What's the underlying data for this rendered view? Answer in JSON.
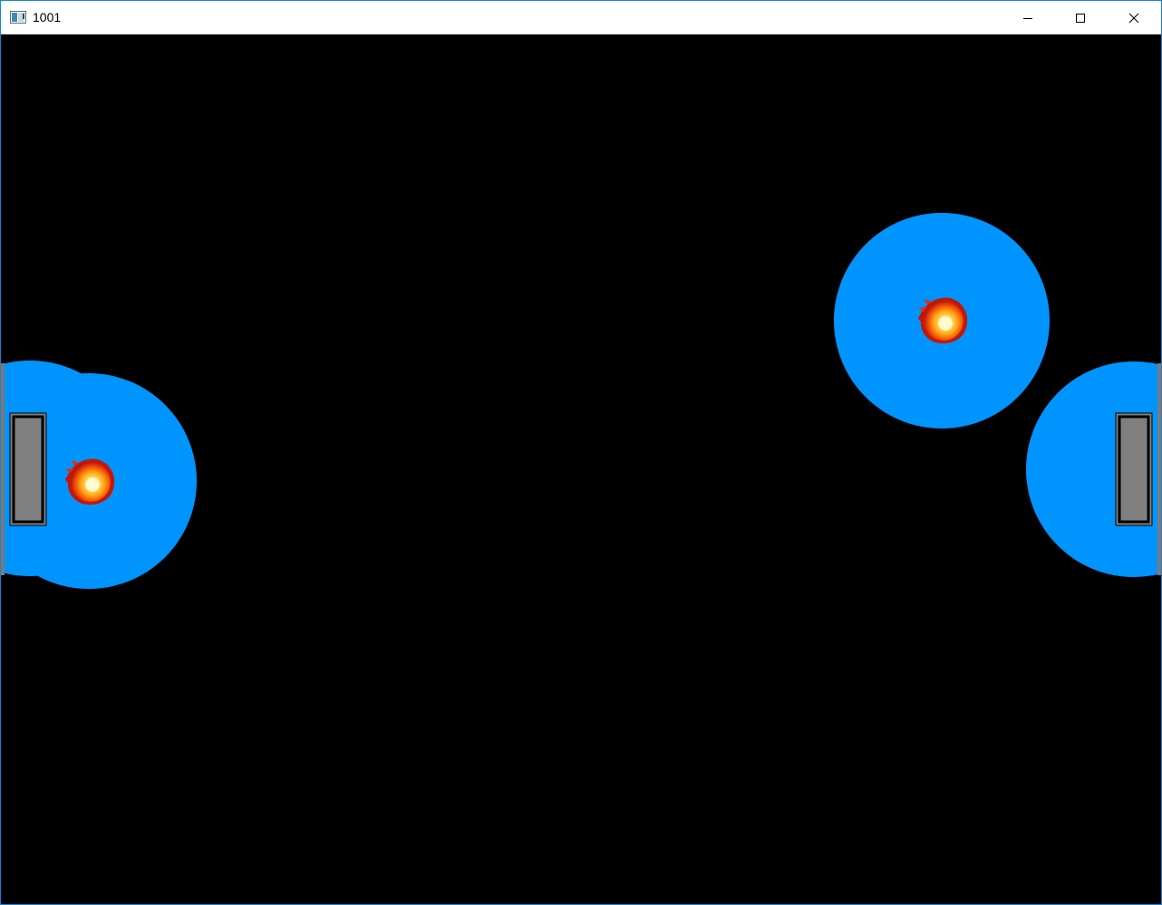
{
  "window": {
    "title": "1001",
    "controls": {
      "minimize_icon": "minimize-icon",
      "maximize_icon": "maximize-icon",
      "close_icon": "close-icon"
    }
  },
  "game": {
    "background_color": "#000000",
    "aura_color": "#0094ff",
    "paddle_color": "#808080",
    "paddle_border_color": "#000000",
    "objects": [
      {
        "kind": "paddle-left",
        "icon": "paddle-icon"
      },
      {
        "kind": "paddle-right",
        "icon": "paddle-icon"
      },
      {
        "kind": "fireball-left",
        "icon": "fireball-icon"
      },
      {
        "kind": "fireball-top-right",
        "icon": "fireball-icon"
      }
    ]
  }
}
